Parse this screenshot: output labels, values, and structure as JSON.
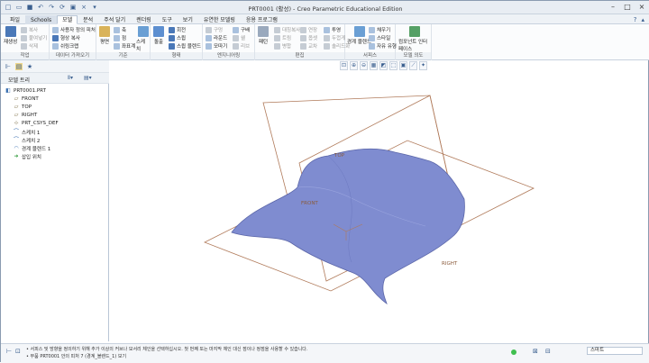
{
  "window": {
    "title": "PRT0001 (활성) - Creo Parametric Educational Edition"
  },
  "menu": {
    "tabs": [
      "파일",
      "Schools",
      "모델",
      "분석",
      "주석 달기",
      "렌더링",
      "도구",
      "보기",
      "유연한 모델링",
      "응용 프로그램"
    ],
    "active_tab": "모델"
  },
  "ribbon": {
    "groups": [
      {
        "label": "작업"
      },
      {
        "label": "데이터 가져오기"
      },
      {
        "label": "기준"
      },
      {
        "label": "형태"
      },
      {
        "label": "엔지니어링"
      },
      {
        "label": "편집"
      },
      {
        "label": "서피스"
      },
      {
        "label": "모델 의도"
      }
    ],
    "buttons": {
      "regen": "재생성",
      "copy": "복사",
      "paste": "붙여넣기",
      "delete": "삭제",
      "user_feature": "사용자 정의 피처",
      "copy_geometry": "형상 복사",
      "shrinkwrap": "쉬링크랩",
      "plane": "평면",
      "axis": "축",
      "point": "점",
      "csys": "좌표계",
      "sketch": "스케치",
      "extrude": "돌출",
      "revolve": "회전",
      "sweep": "스윕",
      "swept_blend": "스윕 블렌드",
      "hole": "구멍",
      "round": "라운드",
      "chamfer": "모따기",
      "shell": "쉘",
      "rib": "리브",
      "draft": "구배",
      "pattern": "패턴",
      "mirror": "대칭복사",
      "trim": "트림",
      "merge": "병합",
      "extend": "연장",
      "offset": "옵셋",
      "intersect": "교차",
      "project": "투영",
      "thicken": "두껍게",
      "solidify": "솔리드화",
      "boundary_blend": "경계 블렌드",
      "fill": "채우기",
      "style": "스타일",
      "freestyle": "자유 유형",
      "component_interface": "컴포넌트 인터페이스"
    }
  },
  "model_tree": {
    "header": "모델 트리",
    "items": [
      {
        "label": "PRT0001.PRT",
        "icon": "part-icon"
      },
      {
        "label": "FRONT",
        "icon": "datum-plane-icon"
      },
      {
        "label": "TOP",
        "icon": "datum-plane-icon"
      },
      {
        "label": "RIGHT",
        "icon": "datum-plane-icon"
      },
      {
        "label": "PRT_CSYS_DEF",
        "icon": "csys-icon"
      },
      {
        "label": "스케치 1",
        "icon": "sketch-icon"
      },
      {
        "label": "스케치 2",
        "icon": "sketch-icon"
      },
      {
        "label": "경계 블렌드 1",
        "icon": "boundary-blend-icon"
      },
      {
        "label": "삽입 위치",
        "icon": "insert-here-icon"
      }
    ]
  },
  "graphics": {
    "datum_labels": [
      "TOP",
      "FRONT",
      "RIGHT"
    ],
    "surface_color": "#7f8cd0",
    "datum_color": "#b07a5a"
  },
  "status": {
    "message1": "• 서피스 및 방향을 정의하기 위해 추가 이상의 커브나 모서리 체인을 선택하십시오. 첫 번째 또는 마지막 체인 대신 점이나 정점을 사용할 수 있습니다.",
    "message2": "• 부품 PRT0001 안의 피처 7 (경계_블렌드_1) 보기",
    "filter": "스마트"
  }
}
